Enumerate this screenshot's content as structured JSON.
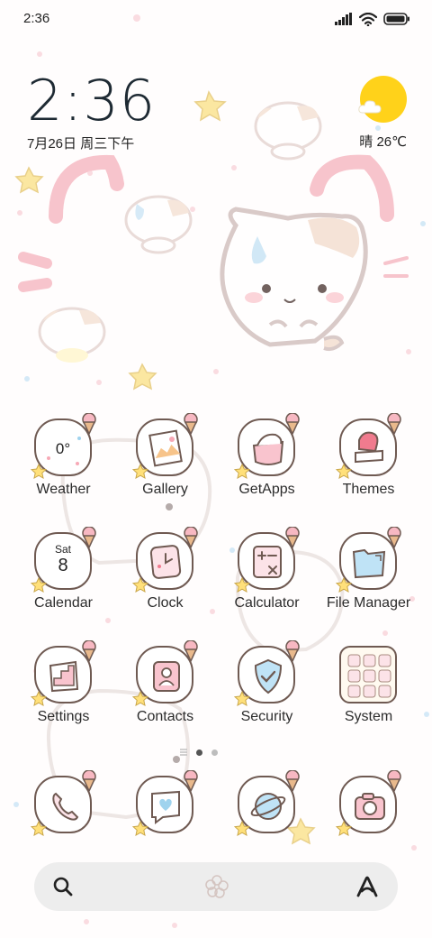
{
  "status_bar": {
    "time": "2:36",
    "icons": [
      "signal-icon",
      "wifi-icon",
      "battery-icon"
    ]
  },
  "clock_widget": {
    "time": "2:36",
    "date": "7月26日 周三下午"
  },
  "weather_widget": {
    "icon": "sun-cloud-icon",
    "condition": "晴",
    "temperature": "26℃"
  },
  "apps": [
    {
      "label": "Weather",
      "icon": "weather-icon",
      "icon_text": "0°"
    },
    {
      "label": "Gallery",
      "icon": "gallery-icon"
    },
    {
      "label": "GetApps",
      "icon": "getapps-icon"
    },
    {
      "label": "Themes",
      "icon": "themes-icon"
    },
    {
      "label": "Calendar",
      "icon": "calendar-icon",
      "icon_day": "Sat",
      "icon_date": "8"
    },
    {
      "label": "Clock",
      "icon": "clock-icon"
    },
    {
      "label": "Calculator",
      "icon": "calculator-icon"
    },
    {
      "label": "File Manager",
      "icon": "folder-icon"
    },
    {
      "label": "Settings",
      "icon": "settings-icon"
    },
    {
      "label": "Contacts",
      "icon": "contacts-icon"
    },
    {
      "label": "Security",
      "icon": "shield-icon"
    },
    {
      "label": "System",
      "icon": "system-folder-icon"
    }
  ],
  "page_indicator": {
    "pages": 2,
    "current": 1
  },
  "dock": [
    {
      "icon": "phone-icon"
    },
    {
      "icon": "messages-icon"
    },
    {
      "icon": "browser-icon"
    },
    {
      "icon": "camera-icon"
    }
  ],
  "search_bar": {
    "left_icon": "search-icon",
    "center_icon": "flower-icon",
    "right_icon": "assistant-icon"
  },
  "colors": {
    "accent_sun": "#ffd21a",
    "icon_outline": "#6f5a52",
    "pink": "#f7a9b6",
    "blue": "#9fd3ee"
  }
}
